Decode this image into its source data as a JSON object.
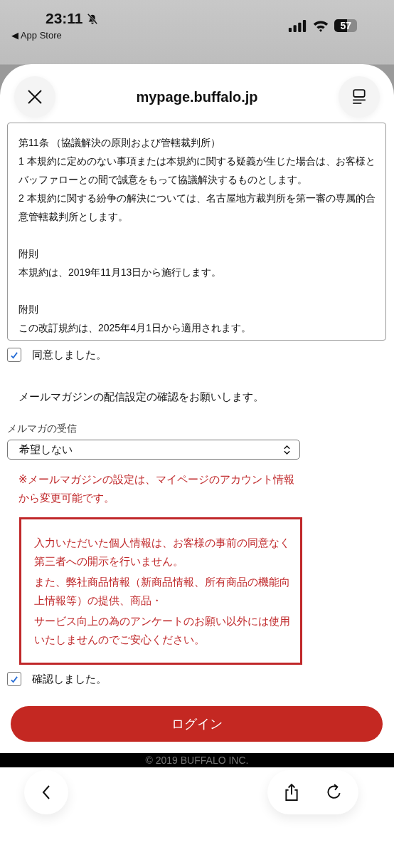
{
  "status_bar": {
    "time": "23:11",
    "back_app": "◀ App Store",
    "battery": "57",
    "muted": true
  },
  "browser_header": {
    "url": "mypage.buffalo.jp"
  },
  "terms": {
    "blocks": [
      [
        "第11条 （協議解決の原則および管轄裁判所）",
        "1 本規約に定めのない事項または本規約に関する疑義が生じた場合は、お客様とバッファローとの間で誠意をもって協議解決するものとします。",
        "2 本規約に関する紛争の解決については、名古屋地方裁判所を第一審の専属的合意管轄裁判所とします。"
      ],
      [
        "附則",
        "本規約は、2019年11月13日から施行します。"
      ],
      [
        "附則",
        "この改訂規約は、2025年4月1日から適用されます。"
      ]
    ]
  },
  "agree_checkbox": {
    "label": "同意しました。",
    "checked": true
  },
  "newsletter_message": "メールマガジンの配信設定の確認をお願いします。",
  "newsletter_select": {
    "label": "メルマガの受信",
    "value": "希望しない"
  },
  "newsletter_note": "※メールマガジンの設定は、マイページのアカウント情報から変更可能です。",
  "privacy_notice": [
    "入力いただいた個人情報は、お客様の事前の同意なく第三者への開示を行いません。",
    "また、弊社商品情報（新商品情報、所有商品の機能向上情報等）の提供、商品・",
    "サービス向上の為のアンケートのお願い以外には使用いたしませんのでご安心ください。"
  ],
  "confirm_checkbox": {
    "label": "確認しました。",
    "checked": true
  },
  "login_button": "ログイン",
  "footer": "© 2019 BUFFALO INC."
}
